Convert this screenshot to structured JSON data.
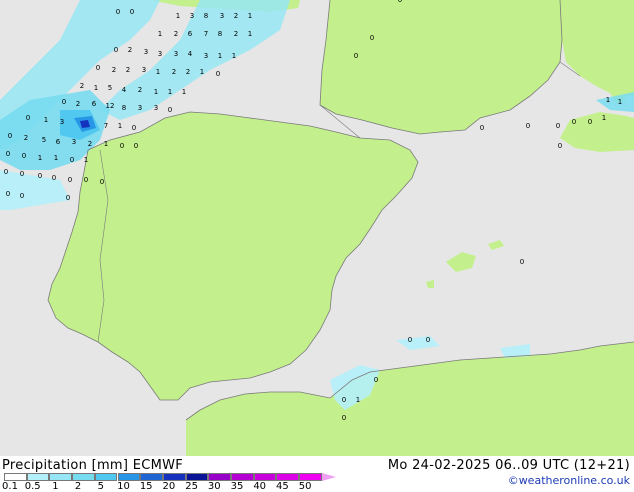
{
  "header": {
    "title": "Precipitation [mm]  ECMWF",
    "datetime": "Mo 24-02-2025 06..09 UTC (12+21)",
    "credit": "©weatheronline.co.uk"
  },
  "legend": {
    "ticks": [
      "0.1",
      "0.5",
      "1",
      "2",
      "5",
      "10",
      "15",
      "20",
      "25",
      "30",
      "35",
      "40",
      "45",
      "50"
    ],
    "colors": [
      "#fefefe",
      "#b4f0fa",
      "#96e6f5",
      "#78dcf0",
      "#50c8f0",
      "#2896e6",
      "#1e64d2",
      "#1432be",
      "#0a1496",
      "#9600c8",
      "#b400d2",
      "#c800dc",
      "#dc00e6",
      "#f000f0"
    ],
    "arrow_color": "#f0a0f0"
  },
  "map": {
    "sea_color": "#e6e6e6",
    "land_color": "#c3f08c",
    "coast_color": "#7a7a7a",
    "precip_labels": [
      "0",
      "1",
      "2",
      "3",
      "4",
      "5",
      "6",
      "7",
      "8",
      "10",
      "12",
      "13"
    ]
  }
}
